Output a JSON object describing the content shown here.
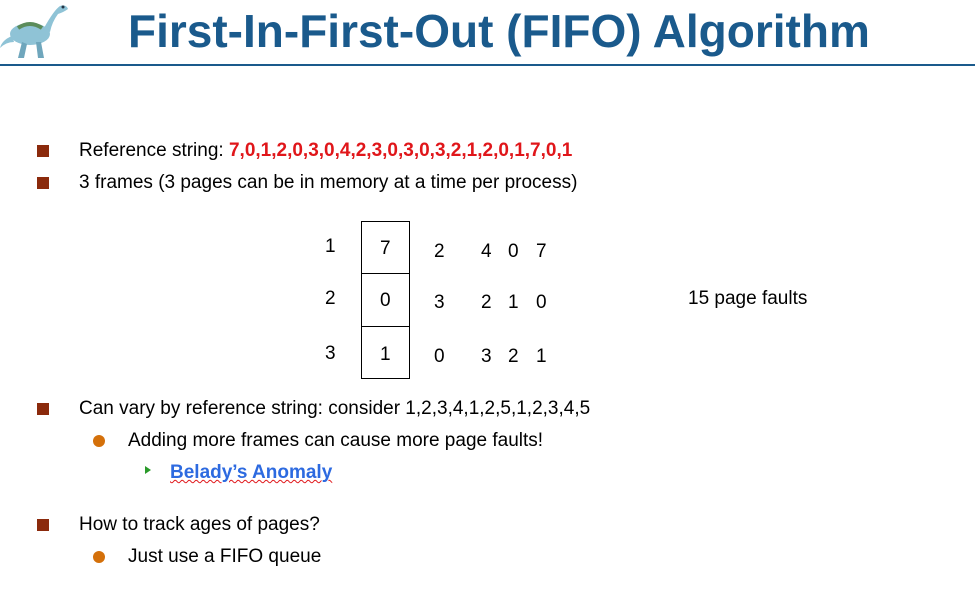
{
  "slide": {
    "title": "First-In-First-Out (FIFO) Algorithm",
    "logo_icon": "dinosaur-logo"
  },
  "bullets": {
    "b1_prefix": "Reference string: ",
    "b1_value": "7,0,1,2,0,3,0,4,2,3,0,3,0,3,2,1,2,0,1,7,0,1",
    "b2": "3 frames (3 pages can be in memory at a time per process)",
    "b3": "Can vary by reference string: consider 1,2,3,4,1,2,5,1,2,3,4,5",
    "b3_sub": "Adding more frames can cause more page faults!",
    "b3_subsub": "Belady’s Anomaly",
    "b4": "How to track ages of pages?",
    "b4_sub": "Just use a FIFO queue"
  },
  "diagram": {
    "row_labels": [
      "1",
      "2",
      "3"
    ],
    "frames": [
      "7",
      "0",
      "1"
    ],
    "columns": [
      [
        "2",
        "3",
        "0"
      ],
      [
        "4",
        "2",
        "3"
      ],
      [
        "0",
        "1",
        "2"
      ],
      [
        "7",
        "0",
        "1"
      ]
    ],
    "faults_label": "15 page faults"
  },
  "colors": {
    "title": "#1a5a8c",
    "reference_string": "#e0161a",
    "link": "#2d6ae0",
    "bullet_square": "#8b2a0c",
    "bullet_circle": "#d4700a",
    "bullet_arrow": "#2a9a2a"
  }
}
